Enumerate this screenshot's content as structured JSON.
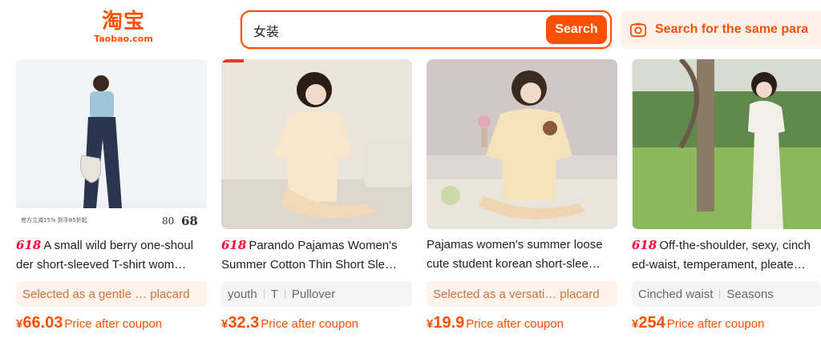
{
  "header": {
    "logo_cn": "淘宝",
    "logo_en": "Taobao.com",
    "search_value": "女装",
    "search_button": "Search",
    "same_search_label": "Search for the same para"
  },
  "products": [
    {
      "badge": "618",
      "title_line1": "A small wild berry one-shoul",
      "title_line2": "der short-sleeved T-shirt wom…",
      "tag_style": "orange",
      "tags": [
        "Selected as a gentle … placard"
      ],
      "currency": "¥",
      "price": "66.03",
      "price_note": "Price after coupon",
      "image_overlay": {
        "text_left": "官方立减15% 到手85折起",
        "num_a": "80",
        "num_b": "68"
      }
    },
    {
      "badge": "618",
      "title_line1": "Parando Pajamas Women's",
      "title_line2": "Summer Cotton Thin Short Sle…",
      "tag_style": "grey",
      "tags": [
        "youth",
        "T",
        "Pullover"
      ],
      "currency": "¥",
      "price": "32.3",
      "price_note": "Price after coupon"
    },
    {
      "badge": "",
      "title_line1": "Pajamas women's summer loose",
      "title_line2": "cute student korean short-slee…",
      "tag_style": "orange",
      "tags": [
        "Selected as a versati… placard"
      ],
      "currency": "¥",
      "price": "19.9",
      "price_note": "Price after coupon"
    },
    {
      "badge": "618",
      "title_line1": "Off-the-shoulder, sexy, cinch",
      "title_line2": "ed-waist, temperament, pleate…",
      "tag_style": "grey",
      "tags": [
        "Cinched waist",
        "Seasons"
      ],
      "currency": "¥",
      "price": "254",
      "price_note": "Price after coupon"
    }
  ],
  "colors": {
    "accent": "#ff5000",
    "badge": "#ff0036",
    "tag_orange_bg": "#fff3eb",
    "tag_grey_bg": "#f5f5f5"
  },
  "icons": {
    "camera": "camera-icon"
  }
}
